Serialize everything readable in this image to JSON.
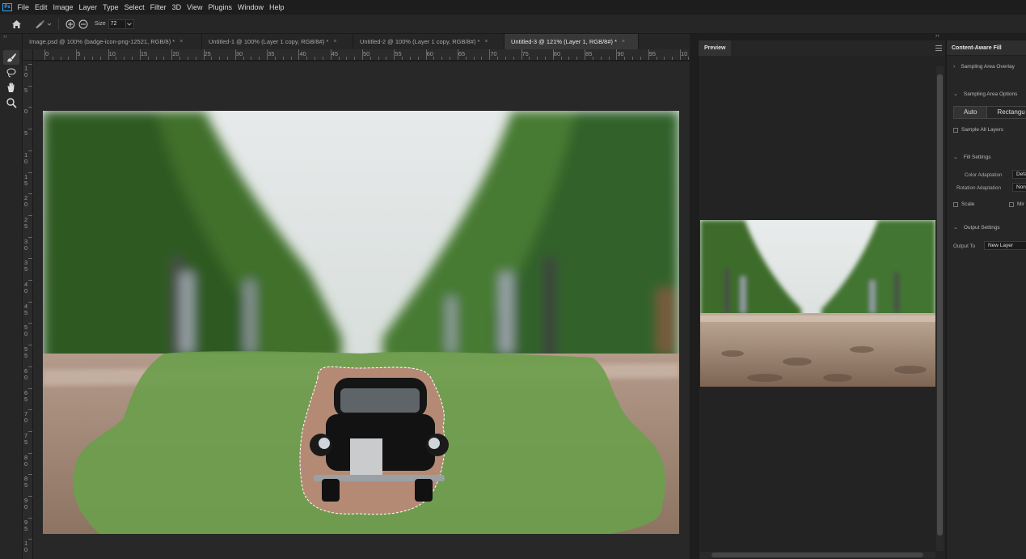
{
  "menubar": {
    "logo": "Ps",
    "items": [
      "File",
      "Edit",
      "Image",
      "Layer",
      "Type",
      "Select",
      "Filter",
      "3D",
      "View",
      "Plugins",
      "Window",
      "Help"
    ]
  },
  "options": {
    "size_label": "Size",
    "size_value": "72"
  },
  "toolbar": {
    "collapse": "››"
  },
  "tabs": [
    {
      "label": "Image.psd @ 100% (badge-icon-png-12521, RGB/8) *",
      "close": "×"
    },
    {
      "label": "Untitled-1 @ 100% (Layer 1 copy, RGB/8#) *",
      "close": "×"
    },
    {
      "label": "Untitled-2 @ 100% (Layer 1 copy, RGB/8#) *",
      "close": "×"
    },
    {
      "label": "Untitled-3 @ 121% (Layer 1, RGB/8#) *",
      "close": "×"
    }
  ],
  "ruler": {
    "h_labels": [
      "0",
      "5",
      "10",
      "15",
      "20",
      "25",
      "30",
      "35",
      "40",
      "45",
      "50",
      "55",
      "60",
      "65",
      "70",
      "75",
      "80",
      "85",
      "90",
      "95",
      "10"
    ],
    "v_labels": [
      "1\n0",
      "5",
      "0",
      "5",
      "1\n0",
      "1\n5",
      "2\n0",
      "2\n5",
      "3\n0",
      "3\n5",
      "4\n0",
      "4\n5",
      "5\n0",
      "5\n5",
      "6\n0",
      "6\n5",
      "7\n0",
      "7\n5",
      "8\n0",
      "8\n5",
      "9\n0",
      "9\n5",
      "1\n0"
    ]
  },
  "preview": {
    "title": "Preview",
    "collapse": "››"
  },
  "caf": {
    "title": "Content-Aware Fill",
    "collapse": "››",
    "sampling_overlay": "Sampling Area Overlay",
    "sampling_options": "Sampling Area Options",
    "seg_auto": "Auto",
    "seg_rect": "Rectangu",
    "sample_all": "Sample All Layers",
    "fill_settings": "Fill Settings",
    "color_adapt_label": "Color Adaptation",
    "color_adapt_value": "Defa",
    "rot_adapt_label": "Rotation Adaptation",
    "rot_adapt_value": "Non",
    "scale": "Scale",
    "mirror": "Mir",
    "output_settings": "Output Settings",
    "output_to_label": "Output To",
    "output_to_value": "New Layer"
  },
  "colors": {
    "accent_ps": "#31a8ff",
    "overlay_green": "#6e9e4e",
    "selection": "#ffffff"
  }
}
